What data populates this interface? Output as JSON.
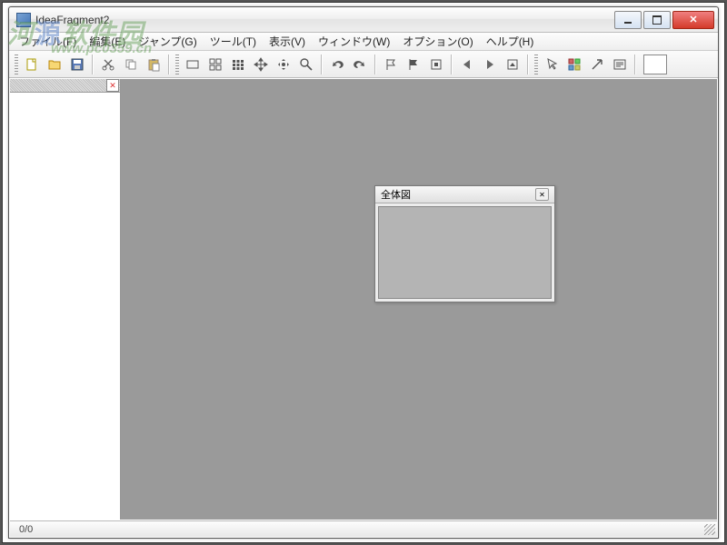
{
  "titlebar": {
    "title": "IdeaFragment2"
  },
  "menu": {
    "file": "ファイル(F)",
    "edit": "編集(E)",
    "jump": "ジャンプ(G)",
    "tool": "ツール(T)",
    "view": "表示(V)",
    "window": "ウィンドウ(W)",
    "option": "オプション(O)",
    "help": "ヘルプ(H)"
  },
  "overview": {
    "title": "全体図",
    "close": "✕"
  },
  "status": {
    "count": "0/0"
  },
  "watermark": {
    "brand_prefix": "河",
    "brand_accent": "源",
    "brand_suffix": "软件园",
    "url": "www.pc0359.cn"
  },
  "icons": {
    "new": "new-file",
    "open": "open-folder",
    "save": "save-disk",
    "cut": "cut",
    "copy": "copy",
    "paste": "paste",
    "rect": "rect",
    "group": "group",
    "grid": "grid",
    "move": "move-4way",
    "move2": "move-drag",
    "search": "magnify",
    "undo": "undo",
    "redo": "redo",
    "flag": "flag",
    "flag2": "flag-fill",
    "stop": "stop-square",
    "prev": "triangle-left",
    "next": "triangle-right",
    "home": "home-square",
    "pointer": "pointer",
    "panel": "panel-grid",
    "link": "link-arrow",
    "note": "note"
  },
  "colors": {
    "titlebar_icon": "#4577b8",
    "close_btn": "#d43a2a",
    "mdi_bg": "#9a9a9a"
  }
}
